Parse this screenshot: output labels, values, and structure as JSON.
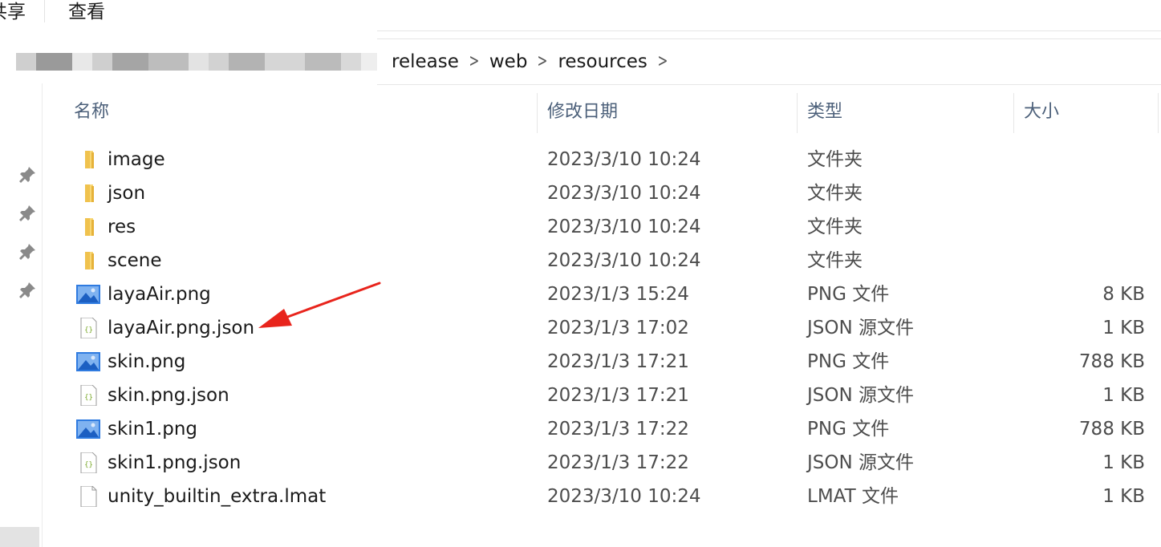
{
  "ribbon": {
    "share_tab": "共享",
    "view_tab": "查看"
  },
  "breadcrumb": [
    {
      "label": "release"
    },
    {
      "label": "web"
    },
    {
      "label": "resources"
    }
  ],
  "columns": {
    "name": "名称",
    "date": "修改日期",
    "type": "类型",
    "size": "大小"
  },
  "files": [
    {
      "name": "image",
      "date": "2023/3/10 10:24",
      "type": "文件夹",
      "size": "",
      "icon": "folder-icon"
    },
    {
      "name": "json",
      "date": "2023/3/10 10:24",
      "type": "文件夹",
      "size": "",
      "icon": "folder-icon"
    },
    {
      "name": "res",
      "date": "2023/3/10 10:24",
      "type": "文件夹",
      "size": "",
      "icon": "folder-icon"
    },
    {
      "name": "scene",
      "date": "2023/3/10 10:24",
      "type": "文件夹",
      "size": "",
      "icon": "folder-icon"
    },
    {
      "name": "layaAir.png",
      "date": "2023/1/3 15:24",
      "type": "PNG 文件",
      "size": "8 KB",
      "icon": "image-file-icon"
    },
    {
      "name": "layaAir.png.json",
      "date": "2023/1/3 17:02",
      "type": "JSON 源文件",
      "size": "1 KB",
      "icon": "json-file-icon"
    },
    {
      "name": "skin.png",
      "date": "2023/1/3 17:21",
      "type": "PNG 文件",
      "size": "788 KB",
      "icon": "image-file-icon"
    },
    {
      "name": "skin.png.json",
      "date": "2023/1/3 17:21",
      "type": "JSON 源文件",
      "size": "1 KB",
      "icon": "json-file-icon"
    },
    {
      "name": "skin1.png",
      "date": "2023/1/3 17:22",
      "type": "PNG 文件",
      "size": "788 KB",
      "icon": "image-file-icon"
    },
    {
      "name": "skin1.png.json",
      "date": "2023/1/3 17:22",
      "type": "JSON 源文件",
      "size": "1 KB",
      "icon": "json-file-icon"
    },
    {
      "name": "unity_builtin_extra.lmat",
      "date": "2023/3/10 10:24",
      "type": "LMAT 文件",
      "size": "1 KB",
      "icon": "blank-file-icon"
    }
  ],
  "colors": {
    "folder": "#f8d775",
    "image_blue": "#2f7be0",
    "annotation_red": "#e8241c",
    "header_text": "#4c607a"
  }
}
